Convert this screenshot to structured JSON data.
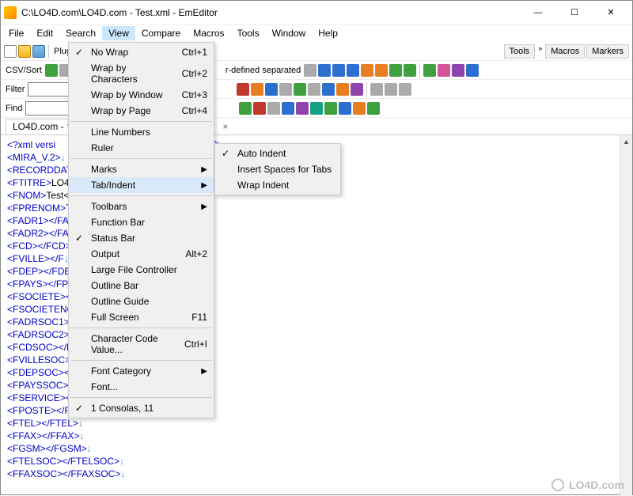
{
  "window": {
    "title": "C:\\LO4D.com\\LO4D.com - Test.xml - EmEditor",
    "min": "—",
    "max": "☐",
    "close": "✕"
  },
  "menubar": [
    "File",
    "Edit",
    "Search",
    "View",
    "Compare",
    "Macros",
    "Tools",
    "Window",
    "Help"
  ],
  "menubar_active_index": 3,
  "toolbars": {
    "row1_label": "Plug-ins",
    "row2_label": "CSV/Sort",
    "row3_label_filter": "Filter",
    "row4_label_find": "Find",
    "row2_text": "r-defined separated",
    "right_tabs": [
      "Tools",
      "Macros",
      "Markers"
    ],
    "chev": "»"
  },
  "file_tab": {
    "name": "LO4D.com -",
    "star": "*",
    "close": "×"
  },
  "view_menu": {
    "items": [
      {
        "label": "No Wrap",
        "shortcut": "Ctrl+1",
        "check": true
      },
      {
        "label": "Wrap by Characters",
        "shortcut": "Ctrl+2"
      },
      {
        "label": "Wrap by Window",
        "shortcut": "Ctrl+3"
      },
      {
        "label": "Wrap by Page",
        "shortcut": "Ctrl+4"
      },
      {
        "sep": true
      },
      {
        "label": "Line Numbers"
      },
      {
        "label": "Ruler"
      },
      {
        "sep": true
      },
      {
        "label": "Marks",
        "sub": true
      },
      {
        "label": "Tab/Indent",
        "sub": true,
        "hl": true
      },
      {
        "sep": true
      },
      {
        "label": "Toolbars",
        "sub": true
      },
      {
        "label": "Function Bar"
      },
      {
        "label": "Status Bar",
        "check": true
      },
      {
        "label": "Output",
        "shortcut": "Alt+2"
      },
      {
        "label": "Large File Controller"
      },
      {
        "label": "Outline Bar"
      },
      {
        "label": "Outline Guide"
      },
      {
        "label": "Full Screen",
        "shortcut": "F11"
      },
      {
        "sep": true
      },
      {
        "label": "Character Code Value...",
        "shortcut": "Ctrl+I"
      },
      {
        "sep": true
      },
      {
        "label": "Font Category",
        "sub": true
      },
      {
        "label": "Font..."
      },
      {
        "sep": true
      },
      {
        "label": "1 Consolas, 11",
        "check": true
      }
    ]
  },
  "submenu": {
    "items": [
      {
        "label": "Auto Indent",
        "check": true
      },
      {
        "label": "Insert Spaces for Tabs"
      },
      {
        "label": "Wrap Indent"
      }
    ]
  },
  "editor_lines": [
    {
      "pre": "<?xml versi",
      "att": "",
      "post": "",
      "tail": " ?>"
    },
    {
      "pre": "<MIRA_V.2>",
      "post": ""
    },
    {
      "pre": "<RECORDDATA",
      "post": ""
    },
    {
      "pre": "<FTITRE>",
      "text": "LO4",
      "close": ""
    },
    {
      "pre": "<FNOM>",
      "text": "Test<"
    },
    {
      "pre": "<FPRENOM>",
      "text": "Te"
    },
    {
      "pre": "<FADR1>",
      "close": "</FA"
    },
    {
      "pre": "<FADR2>",
      "close": "</FA"
    },
    {
      "pre": "<FCD>",
      "close": "</FCD>"
    },
    {
      "pre": "<FVILLE>",
      "close": "</F"
    },
    {
      "pre": "<FDEP>",
      "close": "</FDE"
    },
    {
      "pre": "<FPAYS>",
      "close": "</FP"
    },
    {
      "pre": "<FSOCIETE>",
      "close": "<"
    },
    {
      "pre": "<FSOCIETENO",
      "post": ""
    },
    {
      "pre": "<FADRSOC1>",
      "close": "<"
    },
    {
      "pre": "<FADRSOC2>",
      "close": "<"
    },
    {
      "pre": "<FCDSOC>",
      "close": "</FCDSOC>"
    },
    {
      "pre": "<FVILLESOC>",
      "close": "</FVILLESOC>"
    },
    {
      "pre": "<FDEPSOC>",
      "close": "</FDEPSOC>"
    },
    {
      "pre": "<FPAYSSOC>",
      "close": "</FPAYSSOC>"
    },
    {
      "pre": "<FSERVICE>",
      "close": "</FSERVICE>"
    },
    {
      "pre": "<FPOSTE>",
      "close": "</FPOSTE>"
    },
    {
      "pre": "<FTEL>",
      "close": "</FTEL>"
    },
    {
      "pre": "<FFAX>",
      "close": "</FFAX>"
    },
    {
      "pre": "<FGSM>",
      "close": "</FGSM>"
    },
    {
      "pre": "<FTELSOC>",
      "close": "</FTELSOC>"
    },
    {
      "pre": "<FFAXSOC>",
      "close": "</FFAXSOC>"
    }
  ],
  "watermark": "LO4D.com"
}
